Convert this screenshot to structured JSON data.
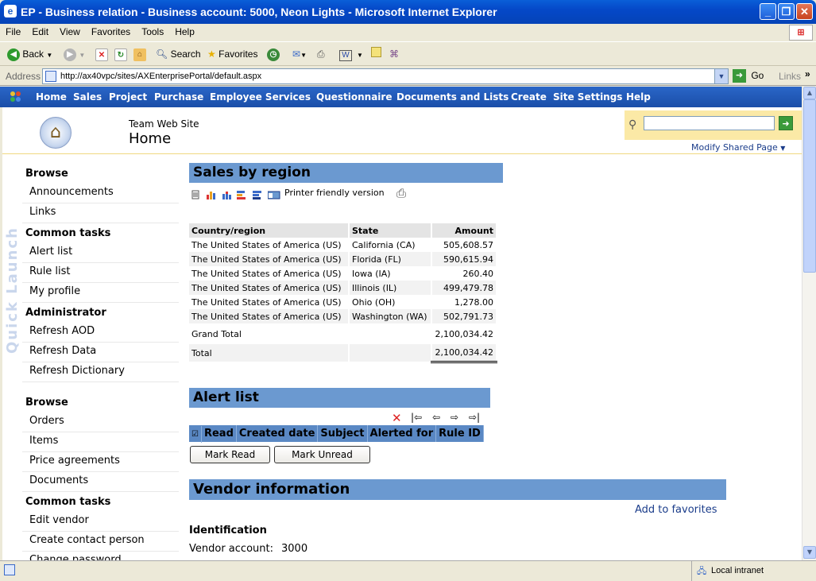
{
  "window": {
    "title": "EP - Business relation - Business account: 5000, Neon Lights - Microsoft Internet Explorer"
  },
  "menubar": {
    "items": [
      "File",
      "Edit",
      "View",
      "Favorites",
      "Tools",
      "Help"
    ]
  },
  "toolbar": {
    "back_label": "Back",
    "search_label": "Search",
    "favorites_label": "Favorites"
  },
  "addressbar": {
    "label": "Address",
    "url": "http://ax40vpc/sites/AXEnterprisePortal/default.aspx",
    "go_label": "Go",
    "links_label": "Links"
  },
  "topnav": {
    "items": [
      "Home",
      "Sales",
      "Project",
      "Purchase",
      "Employee Services",
      "Questionnaire",
      "Documents and Lists",
      "Create",
      "Site Settings",
      "Help"
    ]
  },
  "header": {
    "site_name": "Team Web Site",
    "page_title": "Home",
    "modify_label": "Modify Shared Page"
  },
  "quick_launch": {
    "label": "Quick Launch"
  },
  "leftnav": {
    "browse1": "Browse",
    "announcements": "Announcements",
    "links": "Links",
    "common_tasks1": "Common tasks",
    "alert_list": "Alert list",
    "rule_list": "Rule list",
    "my_profile": "My profile",
    "administrator": "Administrator",
    "refresh_aod": "Refresh AOD",
    "refresh_data": "Refresh Data",
    "refresh_dictionary": "Refresh Dictionary",
    "browse2": "Browse",
    "orders": "Orders",
    "items": "Items",
    "price_agreements": "Price agreements",
    "documents": "Documents",
    "common_tasks2": "Common tasks",
    "edit_vendor": "Edit vendor",
    "create_contact": "Create contact person",
    "cut_item": "Change password"
  },
  "sales": {
    "title": "Sales by region",
    "printer_label": "Printer friendly version",
    "headers": [
      "Country/region",
      "State",
      "Amount"
    ],
    "rows": [
      [
        "The United States of America (US)",
        "California (CA)",
        "505,608.57"
      ],
      [
        "The United States of America (US)",
        "Florida (FL)",
        "590,615.94"
      ],
      [
        "The United States of America (US)",
        "Iowa (IA)",
        "260.40"
      ],
      [
        "The United States of America (US)",
        "Illinois (IL)",
        "499,479.78"
      ],
      [
        "The United States of America (US)",
        "Ohio (OH)",
        "1,278.00"
      ],
      [
        "The United States of America (US)",
        "Washington (WA)",
        "502,791.73"
      ]
    ],
    "grand_total_label": "Grand Total",
    "grand_total": "2,100,034.42",
    "total_label": "Total",
    "total": "2,100,034.42"
  },
  "alerts": {
    "title": "Alert list",
    "columns": [
      "Read",
      "Created date",
      "Subject",
      "Alerted for",
      "Rule ID"
    ],
    "mark_read": "Mark Read",
    "mark_unread": "Mark Unread"
  },
  "vendor": {
    "title": "Vendor information",
    "add_favorites": "Add to favorites",
    "identification": "Identification",
    "account_label": "Vendor account:",
    "account_value": "3000"
  },
  "statusbar": {
    "zone": "Local intranet"
  }
}
